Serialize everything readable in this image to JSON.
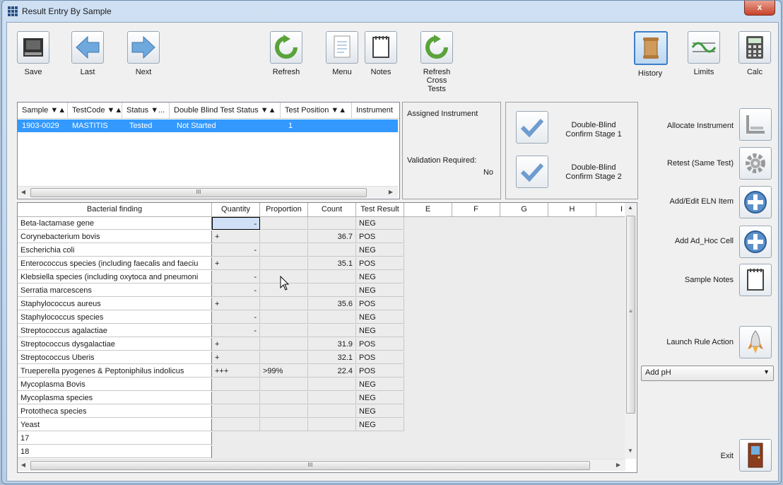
{
  "window": {
    "title": "Result Entry By Sample",
    "close_label": "x"
  },
  "toolbar": {
    "save": "Save",
    "last": "Last",
    "next": "Next",
    "refresh": "Refresh",
    "menu": "Menu",
    "notes": "Notes",
    "refresh_cross_1": "Refresh",
    "refresh_cross_2": "Cross",
    "refresh_cross_3": "Tests",
    "history": "History",
    "limits": "Limits",
    "calc": "Calc"
  },
  "sample_grid": {
    "headers": [
      "Sample ▼▲",
      "TestCode ▼▲",
      "Status ▼...",
      "Double Blind Test Status ▼▲",
      "Test Position ▼▲",
      "Instrument"
    ],
    "row": [
      "1903-0029",
      "MASTITIS",
      "Tested",
      "Not Started",
      "1",
      ""
    ],
    "scroll_grip": "III"
  },
  "instrument_panel": {
    "assigned_label": "Assigned Instrument",
    "validation_label": "Validation Required:",
    "validation_value": "No"
  },
  "double_blind": {
    "stage1_line1": "Double-Blind",
    "stage1_line2": "Confirm Stage 1",
    "stage2_line1": "Double-Blind",
    "stage2_line2": "Confirm Stage 2"
  },
  "result_grid": {
    "headers": [
      "Bacterial finding",
      "Quantity",
      "Proportion",
      "Count",
      "Test Result",
      "E",
      "F",
      "G",
      "H",
      "I"
    ],
    "rows": [
      [
        "Beta-lactamase gene",
        "-",
        "",
        "",
        "NEG"
      ],
      [
        "Corynebacterium bovis",
        "+",
        "",
        "36.7",
        "POS"
      ],
      [
        "Escherichia coli",
        "-",
        "",
        "",
        "NEG"
      ],
      [
        "Enterococcus species (including faecalis and faeciu",
        "+",
        "",
        "35.1",
        "POS"
      ],
      [
        "Klebsiella species (including oxytoca and pneumoni",
        "-",
        "",
        "",
        "NEG"
      ],
      [
        "Serratia marcescens",
        "-",
        "",
        "",
        "NEG"
      ],
      [
        "Staphylococcus aureus",
        "+",
        "",
        "35.6",
        "POS"
      ],
      [
        "Staphylococcus species",
        "-",
        "",
        "",
        "NEG"
      ],
      [
        "Streptococcus agalactiae",
        "-",
        "",
        "",
        "NEG"
      ],
      [
        "Streptococcus dysgalactiae",
        "+",
        "",
        "31.9",
        "POS"
      ],
      [
        "Streptococcus Uberis",
        "+",
        "",
        "32.1",
        "POS"
      ],
      [
        "Trueperella pyogenes & Peptoniphilus indolicus",
        "+++",
        ">99%",
        "22.4",
        "POS"
      ],
      [
        "Mycoplasma Bovis",
        "",
        "",
        "",
        "NEG"
      ],
      [
        "Mycoplasma species",
        "",
        "",
        "",
        "NEG"
      ],
      [
        "Prototheca species",
        "",
        "",
        "",
        "NEG"
      ],
      [
        "Yeast",
        "",
        "",
        "",
        "NEG"
      ]
    ],
    "extra_rows": [
      "17",
      "18"
    ],
    "scroll_grip": "III",
    "vscroll_grip": "≡"
  },
  "side_actions": {
    "allocate": "Allocate Instrument",
    "retest": "Retest (Same Test)",
    "add_eln": "Add/Edit ELN Item",
    "add_adhoc": "Add Ad_Hoc Cell",
    "sample_notes": "Sample Notes",
    "launch_rule": "Launch Rule Action",
    "exit": "Exit"
  },
  "rule_select": {
    "value": "Add pH"
  },
  "colors": {
    "selection": "#3399ff",
    "accent_border": "#3c7fc9"
  }
}
